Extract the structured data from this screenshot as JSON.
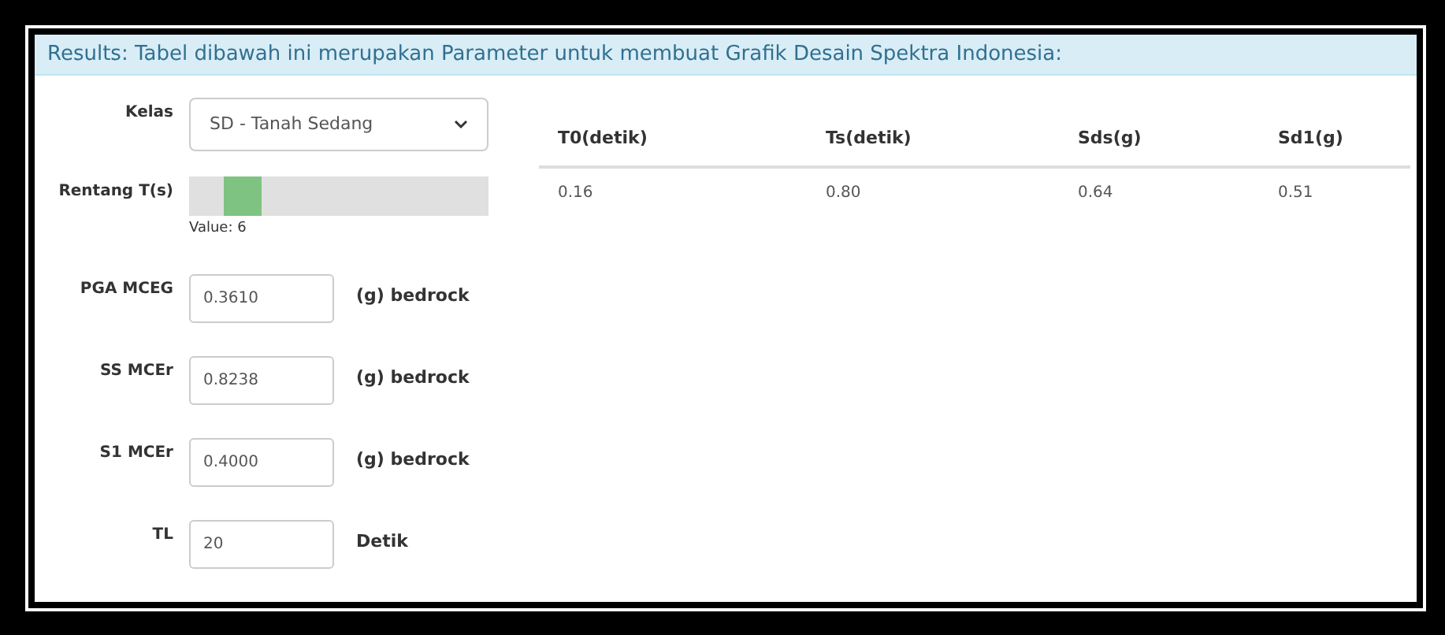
{
  "header": {
    "text": "Results: Tabel dibawah ini merupakan Parameter untuk membuat Grafik Desain Spektra Indonesia:"
  },
  "form": [
    {
      "kind": "select",
      "label": "Kelas",
      "value": "SD - Tanah Sedang"
    },
    {
      "kind": "slider",
      "label": "Rentang T(s)",
      "level": 0.13,
      "reading": "Value: 6"
    },
    {
      "kind": "input",
      "label": "PGA MCEG",
      "value": "0.3610",
      "unit": "(g) bedrock"
    },
    {
      "kind": "input",
      "label": "SS MCEr",
      "value": "0.8238",
      "unit": "(g) bedrock"
    },
    {
      "kind": "input",
      "label": "S1 MCEr",
      "value": "0.4000",
      "unit": "(g) bedrock"
    },
    {
      "kind": "input",
      "label": "TL",
      "value": "20",
      "unit": "Detik"
    }
  ],
  "table": {
    "columns": [
      "T0(detik)",
      "Ts(detik)",
      "Sds(g)",
      "Sd1(g)"
    ],
    "rows": [
      [
        "0.16",
        "0.80",
        "0.64",
        "0.51"
      ]
    ]
  }
}
